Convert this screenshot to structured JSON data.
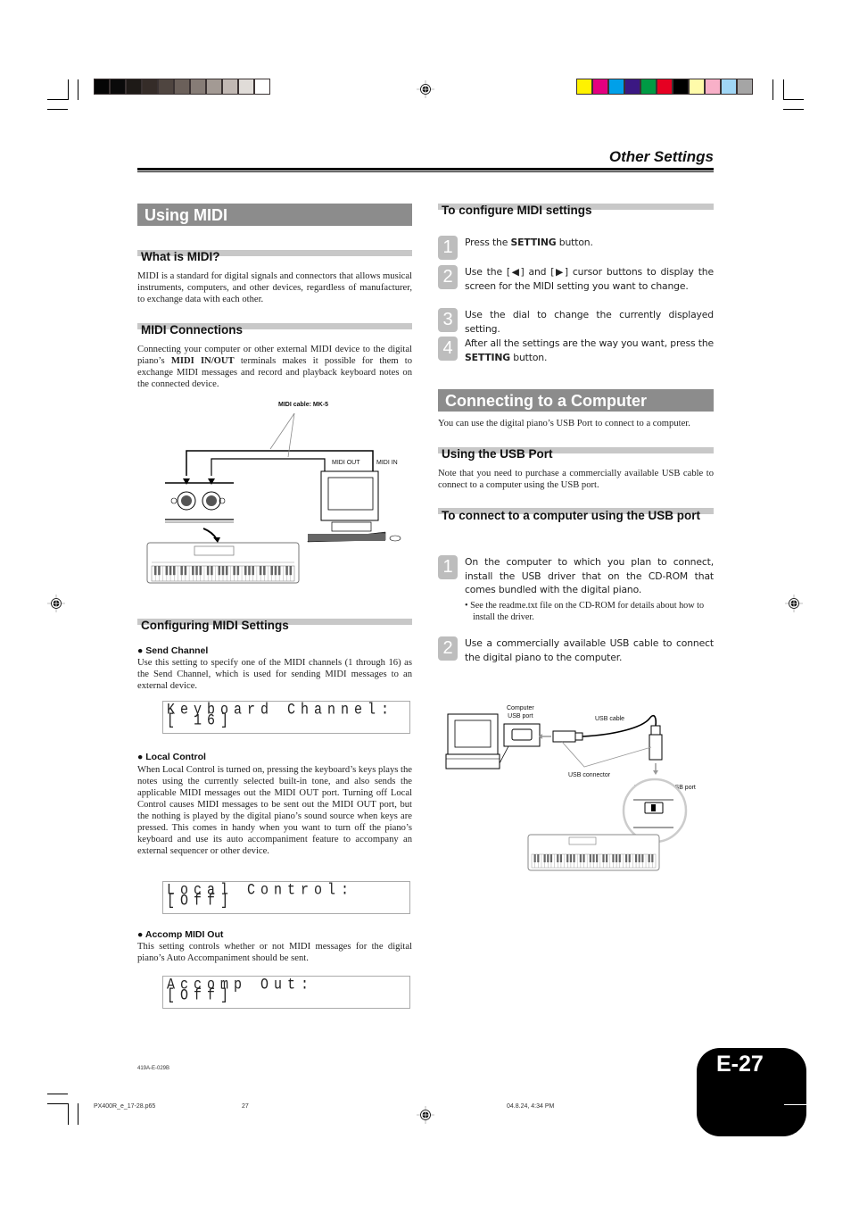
{
  "header": {
    "section_title": "Other Settings",
    "gray_swatches": [
      "#050505",
      "#0a0a0a",
      "#1e1a17",
      "#352c28",
      "#4f4540",
      "#6b605a",
      "#867c76",
      "#a39a94",
      "#c1b8b3",
      "#e0dcd8",
      "#ffffff"
    ],
    "color_swatches": [
      "#fff200",
      "#e4007f",
      "#00a0e9",
      "#3b1883",
      "#009a44",
      "#e60022",
      "#000000",
      "#fffbaa",
      "#f8b0c8",
      "#a0d6f5",
      "#a5a5a5"
    ]
  },
  "left": {
    "using_midi": {
      "title": "Using MIDI",
      "what_is": {
        "heading": "What is MIDI?",
        "text": "MIDI is a standard for digital signals and connectors that allows musical instruments, computers, and other devices, regardless of manufacturer, to exchange data with each other."
      },
      "connections": {
        "heading": "MIDI Connections",
        "text_before": "Connecting your computer or other external MIDI device to the digital piano’s ",
        "text_bold": "MIDI IN/OUT",
        "text_after": " terminals makes it possible for them to exchange MIDI messages and record and playback keyboard notes on the connected device."
      },
      "diagram": {
        "cable_label": "MIDI cable: MK-5",
        "midi_out": "MIDI OUT",
        "midi_in": "MIDI IN"
      }
    },
    "configuring": {
      "heading": "Configuring MIDI Settings",
      "send_channel": {
        "title": "Send Channel",
        "text": "Use this setting to specify one of the MIDI channels (1 through 16) as the Send Channel, which is used for sending MIDI messages to an external device.",
        "lcd_line1": "Keyboard Channel:",
        "lcd_line2": "[ 16]"
      },
      "local_control": {
        "title": "Local Control",
        "text": "When Local Control is turned on, pressing the keyboard’s keys plays the notes using the currently selected built-in tone, and also sends the applicable MIDI messages out the MIDI OUT port. Turning off Local Control causes MIDI messages to be sent out the MIDI OUT port, but the nothing is played by the digital piano’s sound source when keys are pressed. This comes in handy when you want to turn off the piano’s keyboard and use its auto accompaniment feature to accompany an external sequencer or other device.",
        "lcd_line1": "Local Control:",
        "lcd_line2": "[Off]"
      },
      "accomp_out": {
        "title": "Accomp MIDI Out",
        "text": "This setting controls whether or not MIDI messages for the digital piano’s Auto Accompaniment should be sent.",
        "lcd_line1": "Accomp Out:",
        "lcd_line2": "[Off]"
      }
    }
  },
  "right": {
    "configure": {
      "heading": "To configure MIDI settings",
      "steps": [
        {
          "num": "1",
          "pre": "Press the ",
          "bold": "SETTING",
          "post": " button."
        },
        {
          "num": "2",
          "pre": "Use the [◀] and [▶]  cursor buttons to display the screen for the MIDI setting you want to change.",
          "bold": "",
          "post": ""
        },
        {
          "num": "3",
          "pre": "Use the dial to change the currently displayed setting.",
          "bold": "",
          "post": ""
        },
        {
          "num": "4",
          "pre": "After all the settings are the way you want, press the ",
          "bold": "SETTING",
          "post": " button."
        }
      ]
    },
    "connecting": {
      "title": "Connecting to a Computer",
      "intro": "You can use the digital piano’s USB Port to connect to a computer.",
      "usb_port": {
        "heading": "Using the USB Port",
        "text": "Note that you need to purchase a commercially available USB cable to connect to a computer using the USB port."
      },
      "to_connect": {
        "heading": "To connect to a computer using the USB port",
        "steps": [
          {
            "num": "1",
            "text": "On the computer to which you plan to connect, install the USB driver that on the CD-ROM that comes bundled with the digital piano.",
            "sub": "• See the readme.txt file on the CD-ROM for details about how to install the driver."
          },
          {
            "num": "2",
            "text": "Use a commercially available USB cable to connect the digital piano to the computer.",
            "sub": ""
          }
        ]
      },
      "diagram": {
        "computer_port_line1": "Computer",
        "computer_port_line2": "USB port",
        "usb_cable": "USB cable",
        "usb_connector": "USB connector",
        "piano_port": "Digital piano USB port"
      }
    }
  },
  "footer": {
    "code": "419A-E-029B",
    "file": "PX400R_e_17-28.p65",
    "page_num": "27",
    "timestamp": "04.8.24, 4:34 PM",
    "page_label": "E-27"
  }
}
